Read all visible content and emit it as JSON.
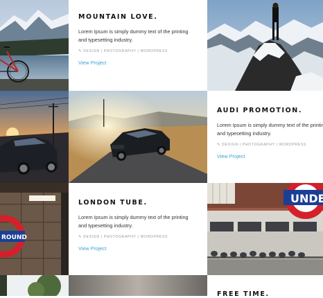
{
  "projects": [
    {
      "title": "MOUNTAIN LOVE.",
      "description": "Lorem Ipsum is simply dummy text of the printing and typesetting industry.",
      "tags": "DESIGN | PHOTOGRAPHY | WORDPRESS",
      "link": "View Project"
    },
    {
      "title": "AUDI PROMOTION.",
      "description": "Lorem Ipsum is simply dummy text of the printing and typesetting industry.",
      "tags": "DESIGN | PHOTOGRAPHY | WORDPRESS",
      "link": "View Project"
    },
    {
      "title": "LONDON TUBE.",
      "description": "Lorem Ipsum is simply dummy text of the printing and typesetting industry.",
      "tags": "DESIGN | PHOTOGRAPHY | WORDPRESS",
      "link": "View Project"
    },
    {
      "title": "FREE TIME."
    }
  ],
  "photos": {
    "tube_sign_text": "UNDE",
    "roundel_text": "ROUND"
  },
  "icons": {
    "tag": "tag-icon"
  },
  "colors": {
    "link": "#3aa0d8",
    "title": "#111111",
    "tags": "#9a9a9a",
    "tube_red": "#d4202a",
    "tube_blue": "#1b3f94"
  }
}
